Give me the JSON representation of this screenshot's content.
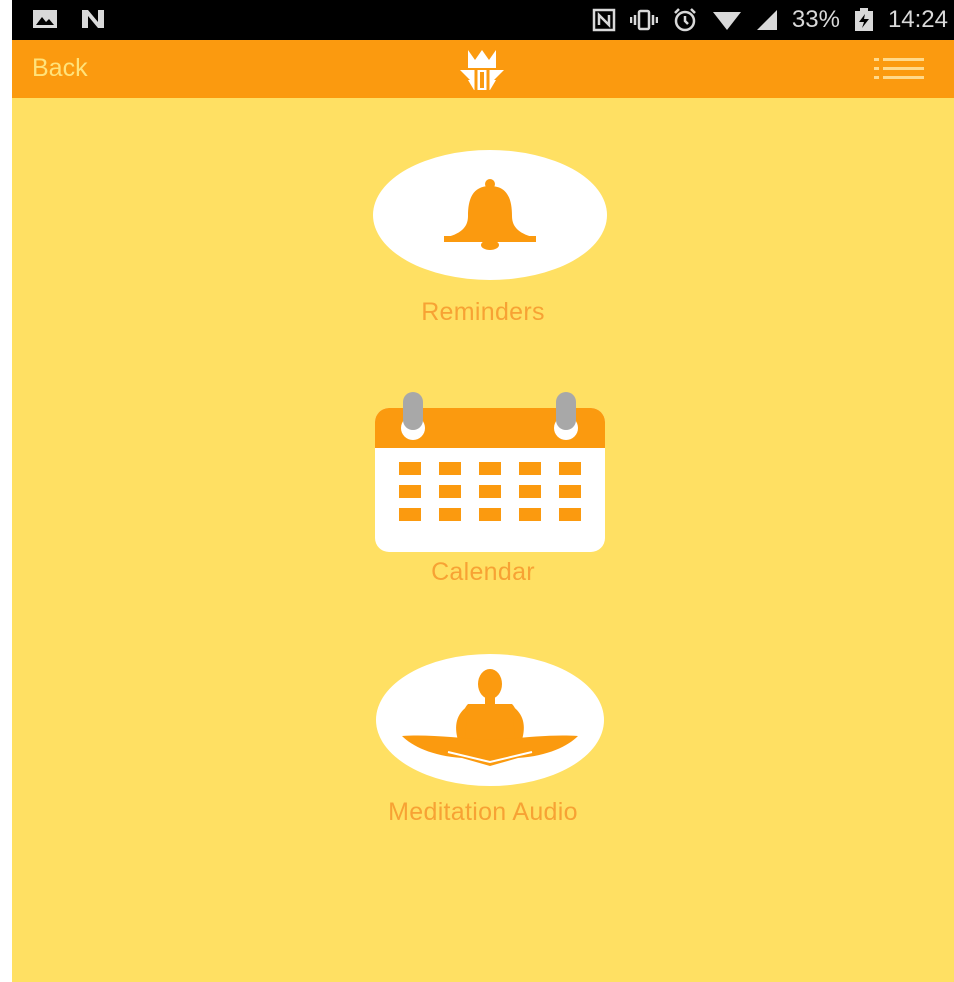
{
  "status_bar": {
    "left_icons": [
      "image-icon",
      "n-notification-icon"
    ],
    "right_icons": [
      "nfc-icon",
      "vibrate-icon",
      "alarm-icon",
      "wifi-icon",
      "signal-icon"
    ],
    "battery": "33%",
    "time": "14:24"
  },
  "app_bar": {
    "back_label": "Back",
    "logo_icon": "app-logo-icon",
    "menu_icon": "hamburger-menu-icon"
  },
  "features": [
    {
      "label": "Reminders",
      "icon": "bell-icon"
    },
    {
      "label": "Calendar",
      "icon": "calendar-icon"
    },
    {
      "label": "Meditation Audio",
      "icon": "meditation-icon"
    }
  ],
  "colors": {
    "app_bar": "#fb9a0f",
    "background": "#ffe063",
    "accent": "#fb9a0f",
    "label": "#f7a234"
  }
}
